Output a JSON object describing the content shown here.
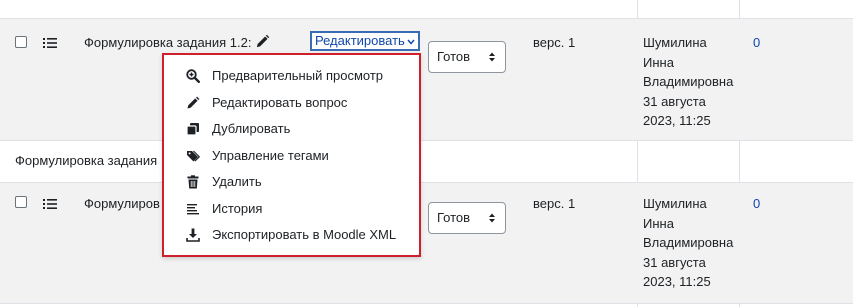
{
  "rows": [
    {
      "question_name": "Формулировка задания 1.2:",
      "edit_label": "Редактировать",
      "status": "Готов",
      "version": "верс. 1",
      "author_line1": "Шумилина",
      "author_line2": "Инна",
      "author_line3": "Владимировна",
      "date_line1": "31 августа",
      "date_line2": "2023, 11:25",
      "usage_count": "0"
    },
    {
      "question_name": "Формулиров",
      "status": "Готов",
      "version": "верс. 1",
      "author_line1": "Шумилина",
      "author_line2": "Инна",
      "author_line3": "Владимировна",
      "date_line1": "31 августа",
      "date_line2": "2023, 11:25",
      "usage_count": "0"
    }
  ],
  "section_heading": "Формулировка задания",
  "edit_menu": {
    "items": [
      {
        "label": "Предварительный просмотр",
        "icon": "search-plus-icon"
      },
      {
        "label": "Редактировать вопрос",
        "icon": "pencil-icon"
      },
      {
        "label": "Дублировать",
        "icon": "copy-icon"
      },
      {
        "label": "Управление тегами",
        "icon": "tags-icon"
      },
      {
        "label": "Удалить",
        "icon": "trash-icon"
      },
      {
        "label": "История",
        "icon": "history-list-icon"
      },
      {
        "label": "Экспортировать в Moodle XML",
        "icon": "download-icon"
      }
    ]
  },
  "colors": {
    "link": "#0f47ad",
    "highlight_border": "#cf1f2b",
    "focus_border": "#3a6cb5",
    "row_bg": "#f2f2f2"
  }
}
